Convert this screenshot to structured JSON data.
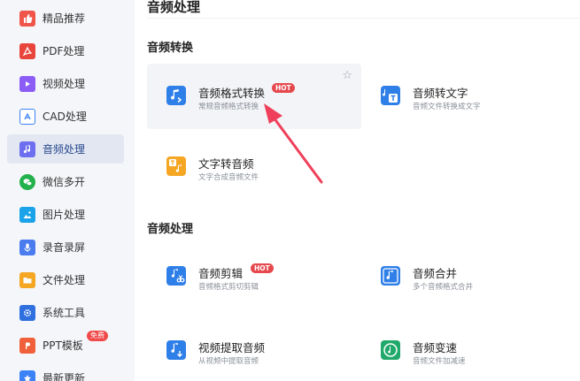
{
  "sidebar": {
    "items": [
      {
        "label": "精品推荐",
        "icon": "thumbs-up-icon",
        "color": "#f0554a"
      },
      {
        "label": "PDF处理",
        "icon": "pdf-icon",
        "color": "#e8453c"
      },
      {
        "label": "视频处理",
        "icon": "video-icon",
        "color": "#8b5cf6"
      },
      {
        "label": "CAD处理",
        "icon": "cad-icon",
        "color": "#3b82f6"
      },
      {
        "label": "音频处理",
        "icon": "music-icon",
        "color": "#6d6ff0"
      },
      {
        "label": "微信多开",
        "icon": "wechat-icon",
        "color": "#22b14c"
      },
      {
        "label": "图片处理",
        "icon": "image-icon",
        "color": "#1aa3e8"
      },
      {
        "label": "录音录屏",
        "icon": "microphone-icon",
        "color": "#4a7cf0"
      },
      {
        "label": "文件处理",
        "icon": "folder-icon",
        "color": "#f5a623"
      },
      {
        "label": "系统工具",
        "icon": "gear-icon",
        "color": "#2f6fe0"
      },
      {
        "label": "PPT模板",
        "icon": "ppt-icon",
        "color": "#f0603a",
        "badge": "免费"
      },
      {
        "label": "最新更新",
        "icon": "update-icon",
        "color": "#3b82f6"
      }
    ]
  },
  "main": {
    "page_title": "音频处理",
    "sections": [
      {
        "title": "音频转换",
        "cards": [
          {
            "title": "音频格式转换",
            "desc": "常规音频格式转换",
            "hot": "HOT",
            "icon": "audio-convert-icon"
          },
          {
            "title": "音频转文字",
            "desc": "音频文件转换成文字",
            "icon": "audio-to-text-icon"
          },
          {
            "title": "文字转音频",
            "desc": "文字合成音频文件",
            "icon": "text-to-audio-icon"
          }
        ]
      },
      {
        "title": "音频处理",
        "cards": [
          {
            "title": "音频剪辑",
            "desc": "音频格式剪切剪辑",
            "hot": "HOT",
            "icon": "audio-cut-icon"
          },
          {
            "title": "音频合并",
            "desc": "多个音频格式合并",
            "icon": "audio-merge-icon"
          },
          {
            "title": "视频提取音频",
            "desc": "从视频中提取音频",
            "icon": "video-extract-audio-icon"
          },
          {
            "title": "音频变速",
            "desc": "音频文件加减速",
            "icon": "audio-speed-icon"
          }
        ]
      }
    ]
  },
  "colors": {
    "accent": "#2a4a8f",
    "hot": "#e5484d",
    "arrow": "#ef3f5a"
  }
}
